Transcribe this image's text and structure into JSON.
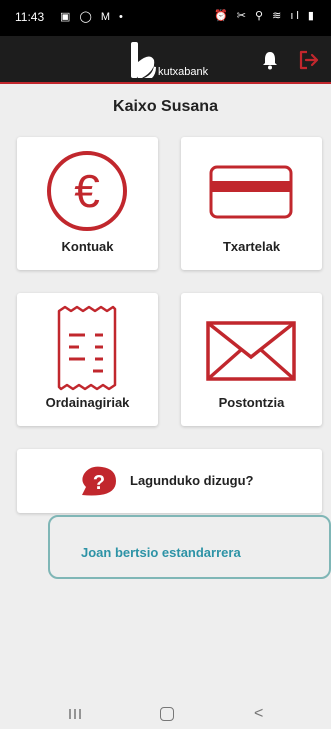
{
  "status_bar": {
    "time": "11:43",
    "left_icons": "▣ ◯ M •",
    "right_icons": "⏰ ✂ ⚲ ≋ ıl ▮"
  },
  "header": {
    "logo_text": "kutxabank",
    "accent_color": "#c1272d"
  },
  "greeting": "Kaixo Susana",
  "tiles": [
    {
      "label": "Kontuak",
      "icon": "euro-icon"
    },
    {
      "label": "Txartelak",
      "icon": "credit-card-icon"
    },
    {
      "label": "Ordainagiriak",
      "icon": "receipt-icon"
    },
    {
      "label": "Postontzia",
      "icon": "envelope-icon"
    }
  ],
  "help": {
    "label": "Lagunduko dizugu?",
    "icon": "question-icon"
  },
  "standard_link": {
    "label": "Joan bertsio estandarrera"
  },
  "nav": {
    "recent": "recent-apps-icon",
    "home": "home-icon",
    "back": "back-icon"
  }
}
